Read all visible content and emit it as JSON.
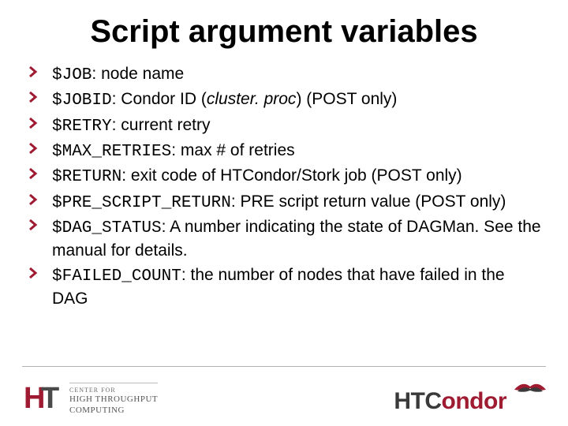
{
  "title": "Script argument variables",
  "items": [
    {
      "var": "$JOB",
      "desc": ": node name"
    },
    {
      "var": "$JOBID",
      "desc_pre": ": Condor ID (",
      "desc_it": "cluster. proc",
      "desc_post": ") (POST only)"
    },
    {
      "var": "$RETRY",
      "desc": ": current retry"
    },
    {
      "var": "$MAX_RETRIES",
      "desc": ": max # of retries"
    },
    {
      "var": "$RETURN",
      "desc": ": exit code of HTCondor/Stork job (POST only)"
    },
    {
      "var": "$PRE_SCRIPT_RETURN",
      "desc": ": PRE script return value (POST only)"
    },
    {
      "var": "$DAG_STATUS",
      "desc": ": A number indicating the state of DAGMan.  See the manual for details."
    },
    {
      "var": "$FAILED_COUNT",
      "desc": ": the number of nodes that have failed in the DAG"
    }
  ],
  "footer": {
    "left_l1": "CENTER FOR",
    "left_l2": "HIGH THROUGHPUT",
    "left_l3": "COMPUTING",
    "right_ht": "HTC",
    "right_ondor": "ondor"
  }
}
